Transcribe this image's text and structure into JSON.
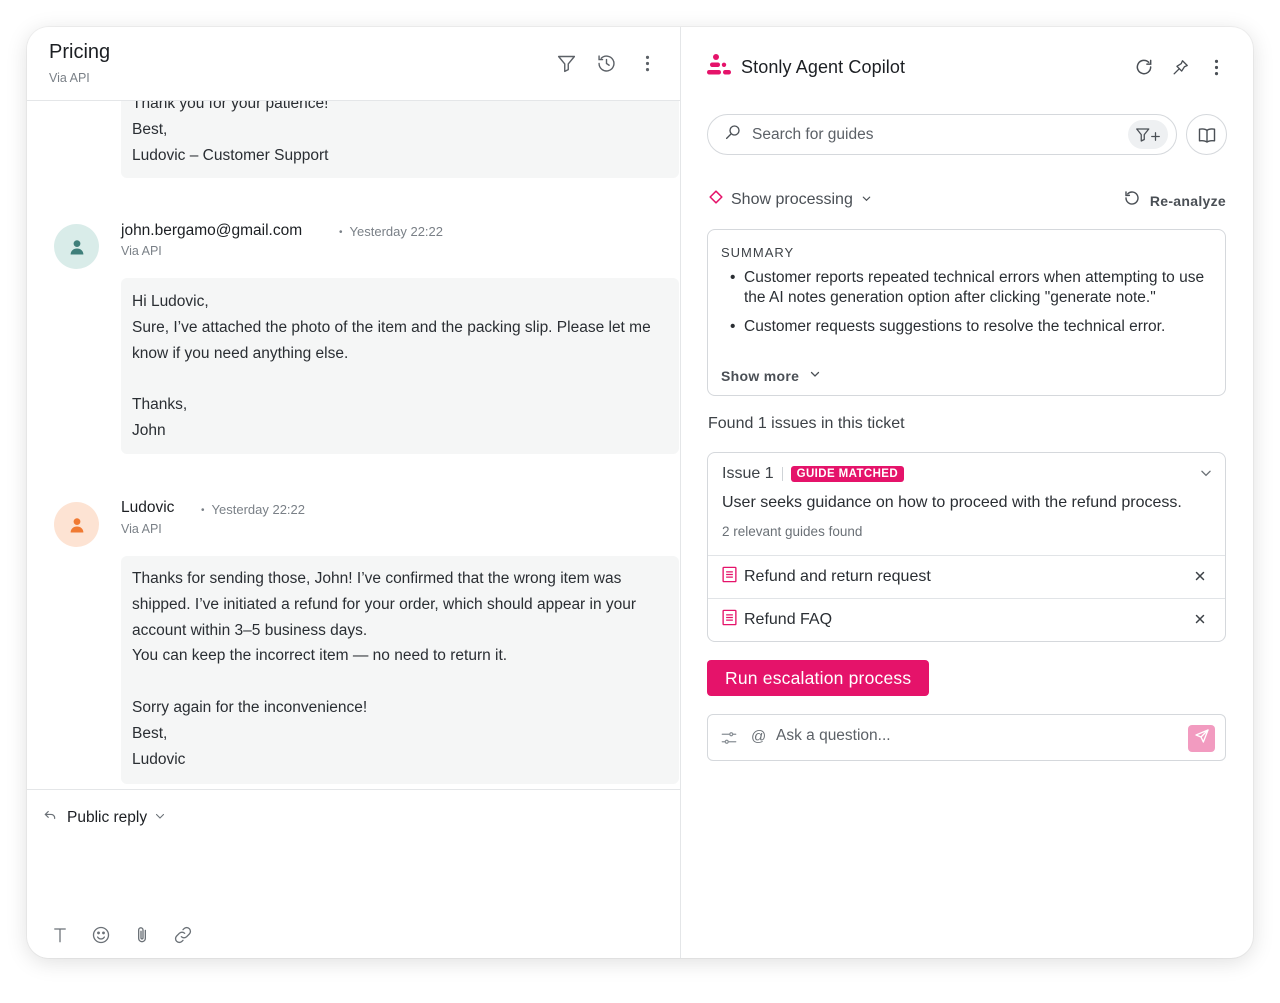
{
  "ticket": {
    "title": "Pricing",
    "subtitle": "Via API"
  },
  "header_icons": [
    "filter-icon",
    "history-icon",
    "more-vertical-icon"
  ],
  "messages": [
    {
      "body": "Thank you for your patience!\nBest,\nLudovic – Customer Support"
    },
    {
      "author": "john.bergamo@gmail.com",
      "time": "Yesterday 22:22",
      "via": "Via API",
      "avatar_color": "#d9ece9",
      "avatar_icon_color": "#3f7f7a",
      "body": "Hi Ludovic,\nSure, I’ve attached the photo of the item and the packing slip. Please let me know if you need anything else.\n\nThanks,\nJohn"
    },
    {
      "author": "Ludovic",
      "time": "Yesterday 22:22",
      "via": "Via API",
      "avatar_color": "#fde3d3",
      "avatar_icon_color": "#f07a33",
      "body": "Thanks for sending those, John! I’ve confirmed that the wrong item was shipped. I’ve initiated a refund for your order, which should appear in your account within 3–5 business days.\nYou can keep the incorrect item — no need to return it.\n\nSorry again for the inconvenience!\nBest,\nLudovic"
    }
  ],
  "reply": {
    "mode_label": "Public reply",
    "toolbar": [
      "text-format-icon",
      "emoji-icon",
      "attachment-icon",
      "link-icon"
    ]
  },
  "copilot": {
    "title": "Stonly Agent Copilot",
    "brand_color": "#e5136a",
    "search": {
      "placeholder": "Search for guides"
    },
    "processing_label": "Show processing",
    "reanalyze_label": "Re-analyze",
    "summary": {
      "title": "SUMMARY",
      "items": [
        "Customer reports repeated technical errors when attempting to use the AI notes generation option after clicking \"generate note.\"",
        "Customer requests suggestions to resolve the technical error."
      ],
      "show_more": "Show more"
    },
    "found_text": "Found 1 issues in this ticket",
    "issue": {
      "label": "Issue 1",
      "badge": "GUIDE MATCHED",
      "description": "User seeks guidance on how to proceed with the refund process.",
      "count_text": "2 relevant guides found",
      "guides": [
        "Refund and return request",
        "Refund FAQ"
      ]
    },
    "run_button": "Run escalation process",
    "ask": {
      "at_symbol": "@",
      "placeholder": "Ask a question..."
    }
  }
}
